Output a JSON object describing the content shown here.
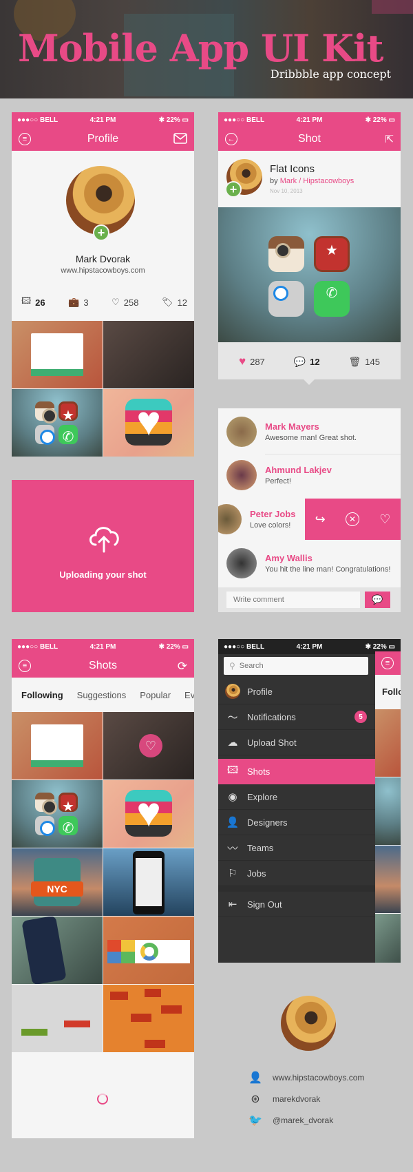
{
  "banner": {
    "title": "Mobile App UI Kit",
    "subtitle": "Dribbble app concept"
  },
  "statusbar": {
    "carrier": "●●●○○ BELL",
    "time": "4:21 PM",
    "battery": "22%"
  },
  "profile_screen": {
    "nav_title": "Profile",
    "left_icon": "menu-icon",
    "right_icon": "mail-icon",
    "name": "Mark Dvorak",
    "website": "www.hipstacowboys.com",
    "stats": [
      {
        "icon": "image-icon",
        "value": "26"
      },
      {
        "icon": "briefcase-icon",
        "value": "3"
      },
      {
        "icon": "heart-icon",
        "value": "258"
      },
      {
        "icon": "tag-icon",
        "value": "12"
      }
    ]
  },
  "shot_screen": {
    "nav_title": "Shot",
    "left_icon": "back-icon",
    "right_icon": "share-icon",
    "shot_title": "Flat Icons",
    "by_prefix": "by",
    "author": "Mark / Hipstacowboys",
    "date": "Nov 10, 2013",
    "likes": "287",
    "comments": "12",
    "views": "145"
  },
  "comments_panel": {
    "items": [
      {
        "name": "Mark Mayers",
        "message": "Awesome man! Great shot."
      },
      {
        "name": "Ahmund Lakjev",
        "message": "Perfect!"
      },
      {
        "name": "Peter Jobs",
        "message": "Love colors!"
      },
      {
        "name": "Amy Wallis",
        "message": "You hit the line man! Congratulations!"
      }
    ],
    "input_placeholder": "Write comment"
  },
  "upload_panel": {
    "label": "Uploading your shot"
  },
  "shots_screen": {
    "nav_title": "Shots",
    "left_icon": "menu-icon",
    "right_icon": "refresh-icon",
    "tabs": [
      "Following",
      "Suggestions",
      "Popular",
      "Ever"
    ],
    "active_tab": "Following"
  },
  "menu_screen": {
    "search_placeholder": "Search",
    "items": [
      {
        "label": "Profile",
        "icon": "avatar"
      },
      {
        "label": "Notifications",
        "icon": "activity-icon",
        "badge": "5"
      },
      {
        "label": "Upload Shot",
        "icon": "cloud-upload-icon"
      },
      {
        "label": "Shots",
        "icon": "image-icon",
        "active": true
      },
      {
        "label": "Explore",
        "icon": "eye-icon"
      },
      {
        "label": "Designers",
        "icon": "user-icon"
      },
      {
        "label": "Teams",
        "icon": "mustache-icon"
      },
      {
        "label": "Jobs",
        "icon": "signpost-icon"
      },
      {
        "label": "Sign Out",
        "icon": "sign-out-icon"
      }
    ],
    "peek_tab": "Follo"
  },
  "contact": {
    "website": "www.hipstacowboys.com",
    "dribbble": "marekdvorak",
    "twitter": "@marek_dvorak"
  },
  "colors": {
    "accent": "#e84a86",
    "menu_bg": "#333333",
    "success": "#6ab04c"
  }
}
